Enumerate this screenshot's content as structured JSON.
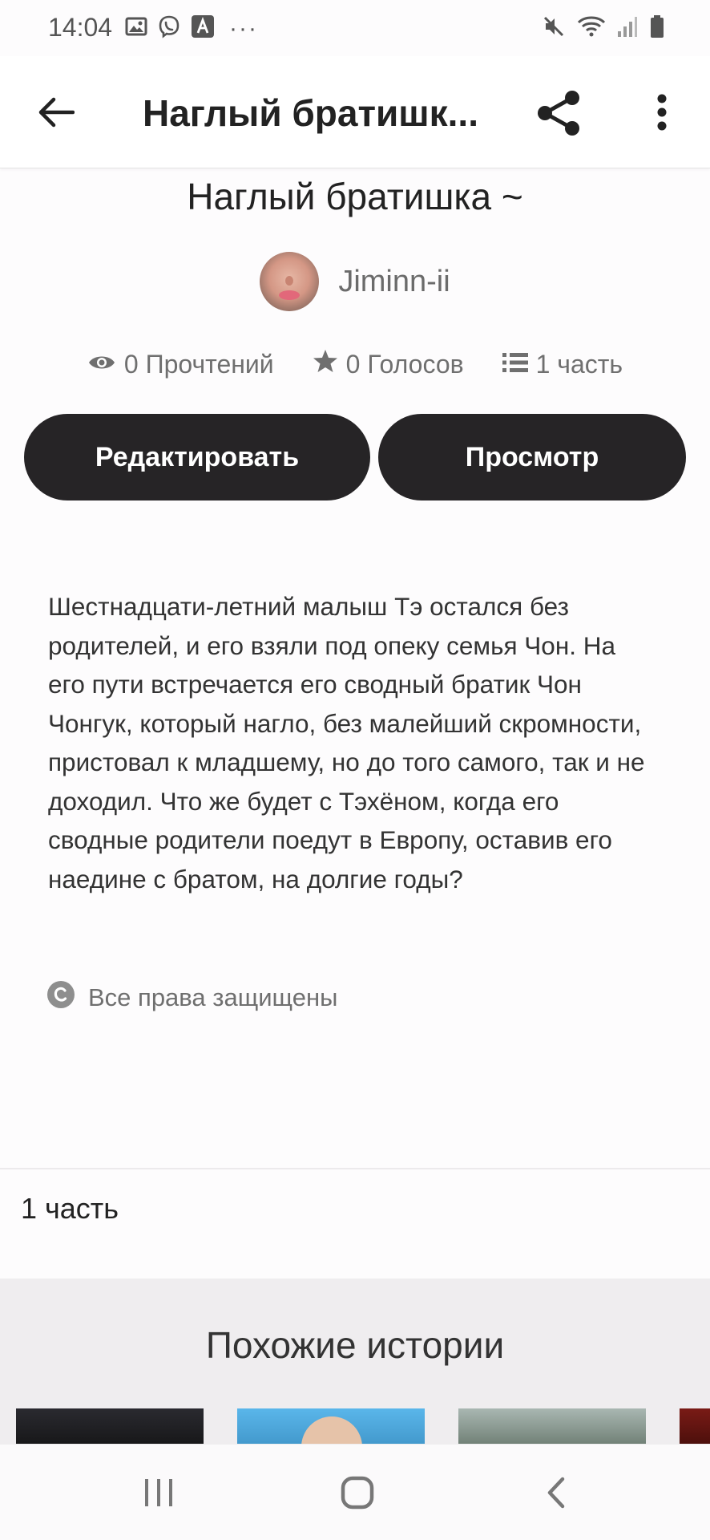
{
  "status_bar": {
    "time": "14:04",
    "left_icons": [
      "gallery-icon",
      "viber-icon",
      "app-icon",
      "more-dots-icon"
    ],
    "right_icons": [
      "mute-icon",
      "wifi-icon",
      "signal-icon",
      "battery-icon"
    ]
  },
  "app_bar": {
    "title": "Наглый братишк...",
    "icons": [
      "back-arrow-icon",
      "share-icon",
      "more-vertical-icon"
    ]
  },
  "story": {
    "title": "Наглый братишка ~",
    "author": "Jiminn-ii",
    "stats": {
      "reads": "0 Прочтений",
      "votes": "0 Голосов",
      "parts": "1 часть"
    },
    "edit_button": "Редактировать",
    "view_button": "Просмотр",
    "description": "Шестнадцати-летний малыш Тэ остался без родителей, и его взяли под опеку семья Чон. На его пути встречается его сводный братик Чон Чонгук, который нагло, без малейший скромности, пристовал к младшему, но до того самого, так и не доходил. Что же будет с Тэхёном, когда его сводные родители поедут в Европу, оставив его наедине с братом, на долгие годы?",
    "copyright": "Все права защищены"
  },
  "parts_section": {
    "label": "1 часть"
  },
  "similar_section": {
    "title": "Похожие истории"
  },
  "nav_bar": {
    "icons": [
      "recent-apps-icon",
      "home-icon",
      "back-icon"
    ]
  },
  "colors": {
    "button_bg": "#262426",
    "button_text": "#ffffff",
    "similar_bg": "#efedef"
  }
}
